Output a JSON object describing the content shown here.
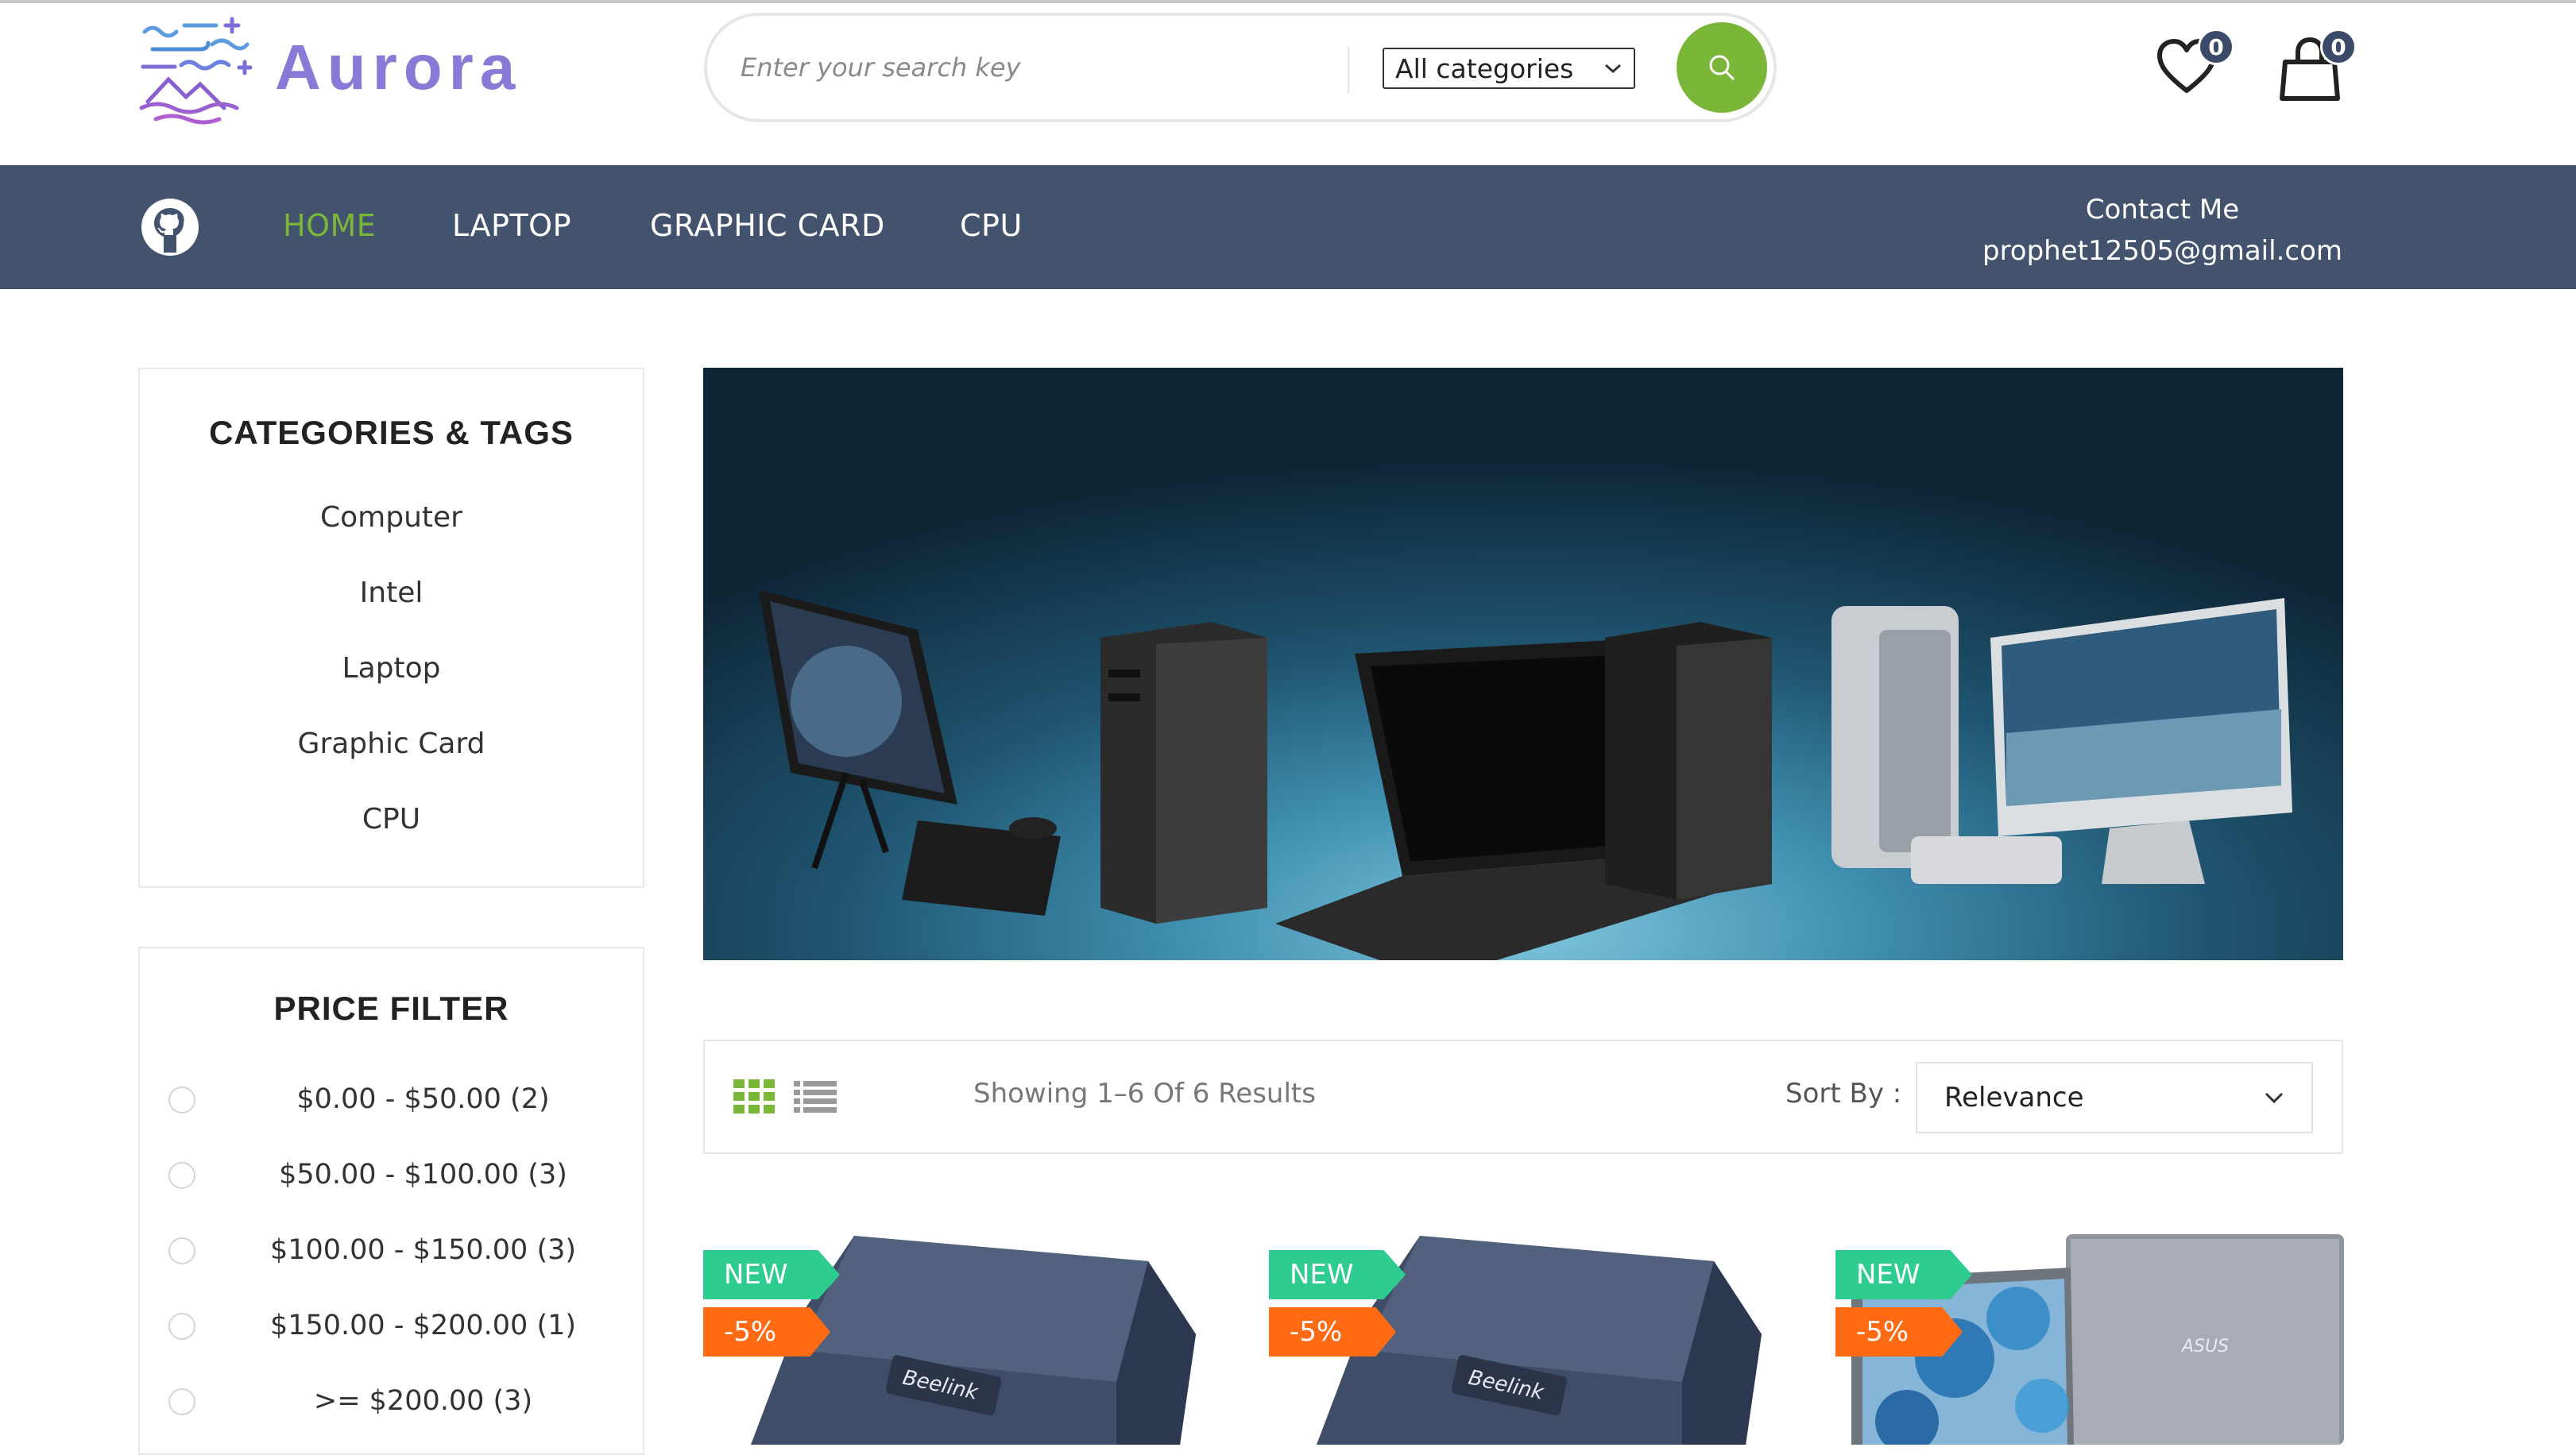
{
  "brand": {
    "name": "Aurora"
  },
  "search": {
    "placeholder": "Enter your search key",
    "category": "All categories"
  },
  "header": {
    "wishlist_count": "0",
    "cart_count": "0"
  },
  "nav": {
    "items": [
      {
        "label": "HOME",
        "active": true
      },
      {
        "label": "LAPTOP",
        "active": false
      },
      {
        "label": "GRAPHIC CARD",
        "active": false
      },
      {
        "label": "CPU",
        "active": false
      }
    ],
    "contact_label": "Contact Me",
    "contact_email": "prophet12505@gmail.com"
  },
  "sidebar": {
    "categories_title": "CATEGORIES & TAGS",
    "categories": [
      "Computer",
      "Intel",
      "Laptop",
      "Graphic Card",
      "CPU"
    ],
    "price_title": "PRICE FILTER",
    "prices": [
      "$0.00 - $50.00 (2)",
      "$50.00 - $100.00 (3)",
      "$100.00 - $150.00 (3)",
      "$150.00 - $200.00 (1)",
      ">= $200.00 (3)"
    ]
  },
  "toolbar": {
    "results": "Showing 1–6 Of 6 Results",
    "sort_label": "Sort By :",
    "sort_value": "Relevance"
  },
  "products": [
    {
      "badge_new": "NEW",
      "badge_discount": "-5%",
      "brand_text": "Beelink"
    },
    {
      "badge_new": "NEW",
      "badge_discount": "-5%",
      "brand_text": "Beelink"
    },
    {
      "badge_new": "NEW",
      "badge_discount": "-5%",
      "brand_text": "ASUS"
    }
  ],
  "colors": {
    "accent": "#7ab637",
    "nav_bg": "#43536e",
    "badge_bg": "#3b4a68",
    "tag_new": "#2ecc8f",
    "tag_discount": "#ff6a13"
  }
}
